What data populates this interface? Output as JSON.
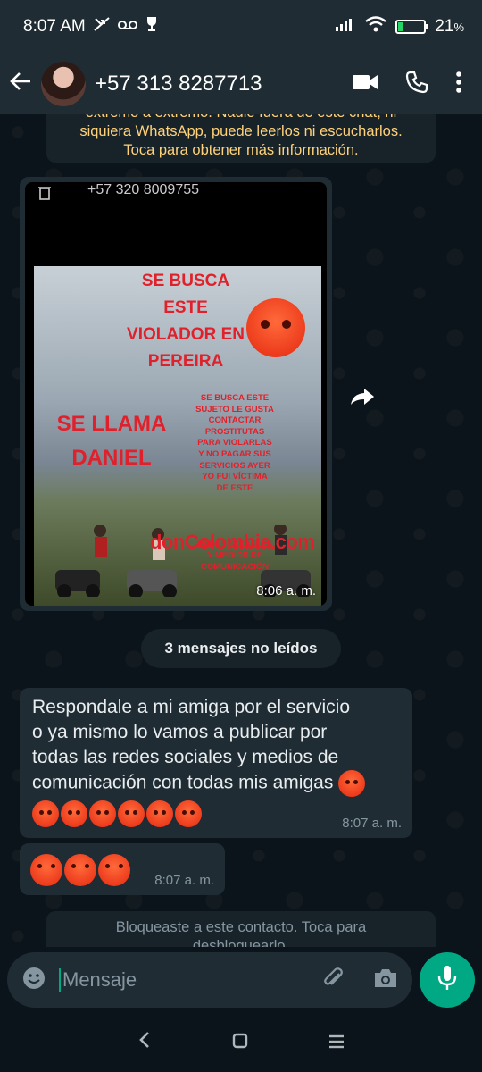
{
  "status_bar": {
    "time": "8:07 AM",
    "battery": "21",
    "battery_suffix": "%",
    "battery_level": 0.21,
    "icons": [
      "missed-call-icon",
      "voicemail-icon",
      "trophy-icon",
      "signal-icon",
      "wifi-icon",
      "battery-icon"
    ]
  },
  "header": {
    "contact": "+57 313 8287713",
    "icons": [
      "back-arrow-icon",
      "video-call-icon",
      "phone-icon",
      "more-vert-icon"
    ]
  },
  "encryption_notice": {
    "line1": "extremo a extremo. Nadie fuera de este chat, ni",
    "line2": "siquiera WhatsApp, puede leerlos ni escucharlos.",
    "line3": "Toca para obtener más información."
  },
  "image_message": {
    "top_text": "+57 320 8009755",
    "time": "8:06 a. m.",
    "poster": {
      "headline_lines": [
        "SE BUSCA",
        "ESTE",
        "VIOLADOR EN",
        "PEREIRA"
      ],
      "name_lines": [
        "SE LLAMA",
        "DANIEL"
      ],
      "body_lines": [
        "SE BUSCA ESTE",
        "SUJETO LE GUSTA",
        "CONTACTAR",
        "PROSTITUTAS",
        "PARA VIOLARLAS",
        "Y NO PAGAR SUS",
        "SERVICIOS AYER",
        "YO FUI VÍCTIMA",
        "DE ESTE",
        "",
        "",
        "",
        "",
        "REDES SOCIALES",
        "Y MEDIOS DE",
        "COMUNICACIÓN"
      ],
      "watermark": "donColombia.com"
    }
  },
  "unread_pill": "3 mensajes no leídos",
  "messages": [
    {
      "lines": [
        "Respondale a mi amiga por el servicio",
        "o ya mismo lo vamos a publicar por",
        "todas las redes sociales y medios de",
        "comunicación con todas mis amigas"
      ],
      "emoji_inline": 1,
      "emoji_row": 6,
      "time": "8:07 a. m."
    },
    {
      "emoji_row": 3,
      "time": "8:07 a. m."
    }
  ],
  "blocked_notice": {
    "line1": "Bloqueaste a este contacto. Toca para",
    "line2": "desbloquearlo."
  },
  "composer": {
    "placeholder": "Mensaje",
    "icons": [
      "emoji-icon",
      "attach-icon",
      "camera-icon",
      "mic-icon"
    ]
  },
  "nav": {
    "icons": [
      "nav-back-icon",
      "nav-home-icon",
      "nav-recents-icon"
    ]
  }
}
